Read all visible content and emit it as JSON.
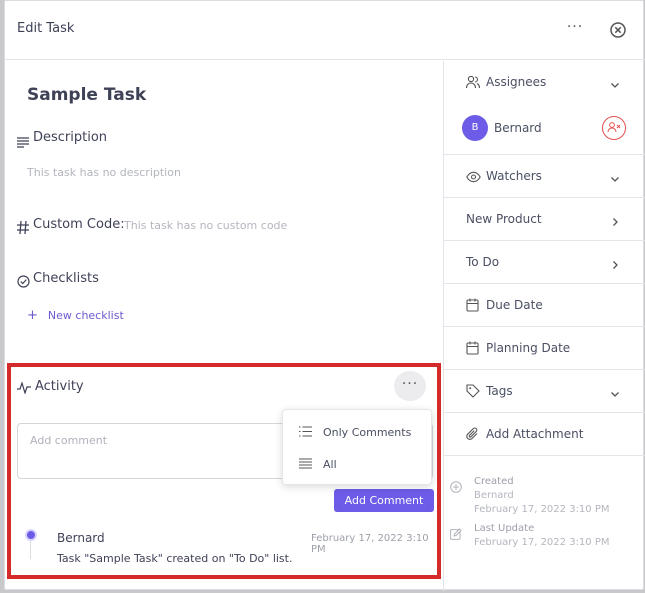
{
  "header": {
    "title": "Edit Task",
    "more_glyph": "···"
  },
  "task": {
    "title": "Sample Task"
  },
  "description": {
    "label": "Description",
    "placeholder": "This task has no description"
  },
  "custom_code": {
    "label": "Custom Code:",
    "placeholder": "This task has no custom code"
  },
  "checklists": {
    "label": "Checklists",
    "new_label": "New checklist"
  },
  "activity": {
    "label": "Activity",
    "more_glyph": "···",
    "comment_placeholder": "Add comment",
    "add_comment_label": "Add Comment",
    "menu": [
      {
        "label": "Only Comments",
        "icon": "list-icon"
      },
      {
        "label": "All",
        "icon": "lines-icon"
      }
    ],
    "entries": [
      {
        "user": "Bernard",
        "date": "February 17, 2022 3:10 PM",
        "text": "Task \"Sample Task\" created on \"To Do\" list."
      }
    ]
  },
  "sidebar": {
    "assignees_label": "Assignees",
    "assignee": {
      "initial": "B",
      "name": "Bernard"
    },
    "watchers_label": "Watchers",
    "project_label": "New Product",
    "list_label": "To Do",
    "due_date_label": "Due Date",
    "planning_date_label": "Planning Date",
    "tags_label": "Tags",
    "attachment_label": "Add Attachment",
    "created": {
      "label": "Created",
      "by": "Bernard",
      "date": "February 17, 2022 3:10 PM"
    },
    "updated": {
      "label": "Last Update",
      "date": "February 17, 2022 3:10 PM"
    }
  },
  "colors": {
    "accent": "#6c5ce7",
    "highlight": "#d42a2a",
    "remove": "#e35050"
  }
}
